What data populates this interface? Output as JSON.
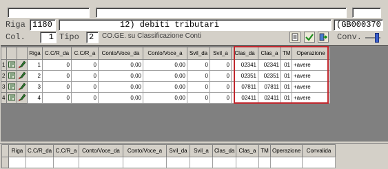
{
  "header": {
    "riga_label": "Riga",
    "riga_value": "1180",
    "title_value": "12) debiti tributari",
    "code_value": "(GB000370)",
    "col_label": "Col.",
    "col_value": "1",
    "tipo_label": "Tipo",
    "tipo_value": "2",
    "tipo_desc": "CO.GE. su Classificazione Conti",
    "conv_label": "Conv."
  },
  "toolbar": {
    "icons": [
      "document-icon",
      "check-icon",
      "exit-icon"
    ]
  },
  "main_grid": {
    "columns": [
      "Riga",
      "C.C/R_da",
      "C.C/R_a",
      "Conto/Voce_da",
      "Conto/Voce_a",
      "Svil_da",
      "Svil_a",
      "Clas_da",
      "Clas_a",
      "TM",
      "Operazione"
    ],
    "rows": [
      {
        "n": "1",
        "riga": "1",
        "ccr_da": "0",
        "ccr_a": "0",
        "conto_da": "0,00",
        "conto_a": "0,00",
        "svil_da": "0",
        "svil_a": "0",
        "clas_da": "02341",
        "clas_a": "02341",
        "tm": "01",
        "op": "+avere"
      },
      {
        "n": "2",
        "riga": "2",
        "ccr_da": "0",
        "ccr_a": "0",
        "conto_da": "0,00",
        "conto_a": "0,00",
        "svil_da": "0",
        "svil_a": "0",
        "clas_da": "02351",
        "clas_a": "02351",
        "tm": "01",
        "op": "+avere"
      },
      {
        "n": "3",
        "riga": "3",
        "ccr_da": "0",
        "ccr_a": "0",
        "conto_da": "0,00",
        "conto_a": "0,00",
        "svil_da": "0",
        "svil_a": "0",
        "clas_da": "07811",
        "clas_a": "07811",
        "tm": "01",
        "op": "+avere"
      },
      {
        "n": "4",
        "riga": "4",
        "ccr_da": "0",
        "ccr_a": "0",
        "conto_da": "0,00",
        "conto_a": "0,00",
        "svil_da": "0",
        "svil_a": "0",
        "clas_da": "02411",
        "clas_a": "02411",
        "tm": "01",
        "op": "+avere"
      }
    ],
    "highlight_color": "#c0272d"
  },
  "bottom_grid": {
    "columns": [
      "Riga",
      "C.C/R_da",
      "C.C/R_a",
      "Conto/Voce_da",
      "Conto/Voce_a",
      "Svil_da",
      "Svil_a",
      "Clas_da",
      "Clas_a",
      "TM",
      "Operazione",
      "Convalida"
    ]
  }
}
